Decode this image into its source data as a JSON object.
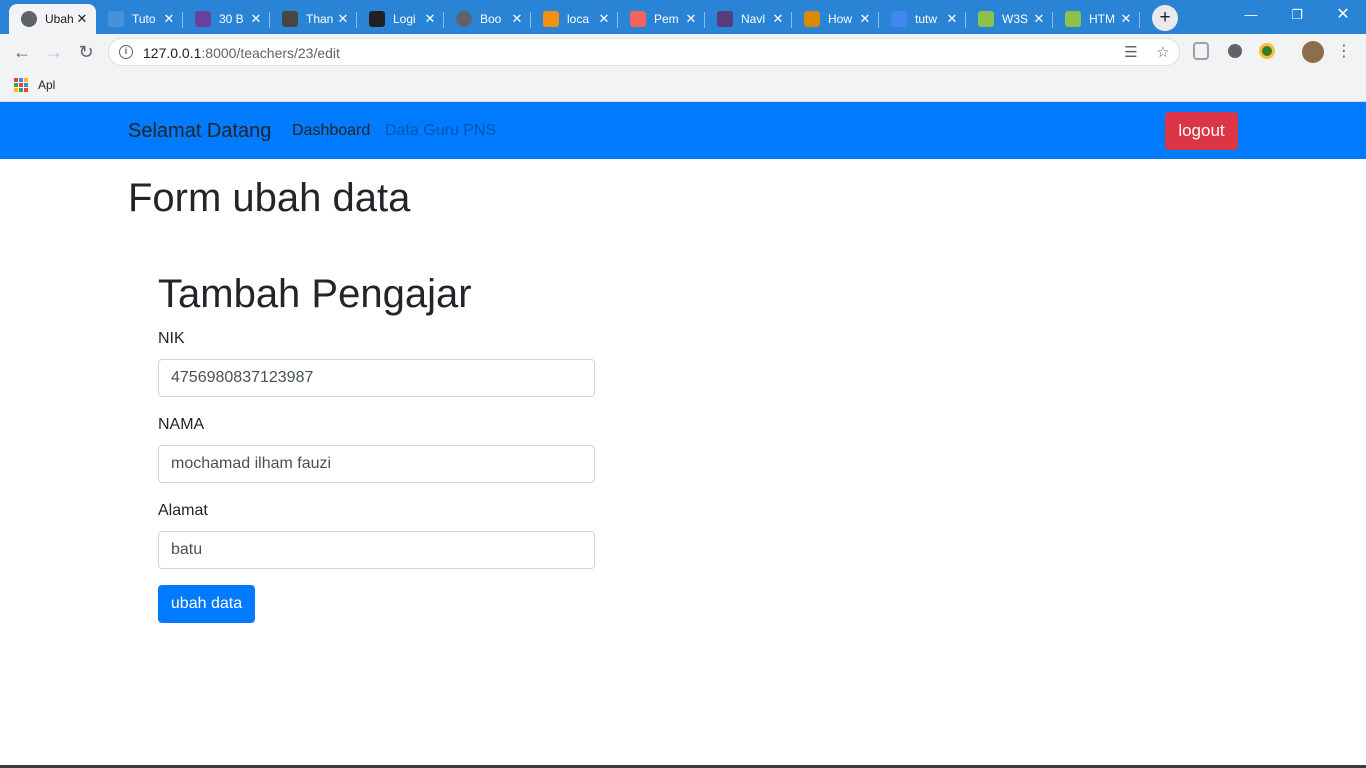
{
  "browser": {
    "tabs": [
      {
        "title": "Ubah",
        "favicon": "globe-icon",
        "color": "#5f6368"
      },
      {
        "title": "Tuto",
        "favicon": "link-icon",
        "color": "#4a90d9"
      },
      {
        "title": "30 B",
        "favicon": "colorlib-icon",
        "color": "#6b3fa0"
      },
      {
        "title": "Than",
        "favicon": "wordpress-icon",
        "color": "#464646"
      },
      {
        "title": "Logi",
        "favicon": "home-icon",
        "color": "#202124"
      },
      {
        "title": "Boo",
        "favicon": "globe-icon",
        "color": "#5f6368"
      },
      {
        "title": "loca",
        "favicon": "phpmyadmin-icon",
        "color": "#f29111"
      },
      {
        "title": "Pem",
        "favicon": "laravel-icon",
        "color": "#f4645f"
      },
      {
        "title": "Navl",
        "favicon": "bootstrap-icon",
        "color": "#563d7c"
      },
      {
        "title": "How",
        "favicon": "w3-icon",
        "color": "#d98a00"
      },
      {
        "title": "tutw",
        "favicon": "google-icon",
        "color": "#4285f4"
      },
      {
        "title": "W3S",
        "favicon": "w3schools-icon",
        "color": "#8bc34a"
      },
      {
        "title": "HTM",
        "favicon": "w3schools-icon",
        "color": "#8bc34a"
      }
    ],
    "url_host": "127.0.0.1",
    "url_path": ":8000/teachers/23/edit",
    "bookmark_label": "Apl"
  },
  "navbar": {
    "brand": "Selamat Datang",
    "links": [
      "Dashboard",
      "Data Guru PNS"
    ],
    "logout": "logout",
    "bg_color": "#007bff"
  },
  "page": {
    "title": "Form ubah data",
    "form_title": "Tambah Pengajar",
    "fields": [
      {
        "label": "NIK",
        "value": "4756980837123987"
      },
      {
        "label": "NAMA",
        "value": "mochamad ilham fauzi"
      },
      {
        "label": "Alamat",
        "value": "batu"
      }
    ],
    "submit": "ubah data"
  }
}
